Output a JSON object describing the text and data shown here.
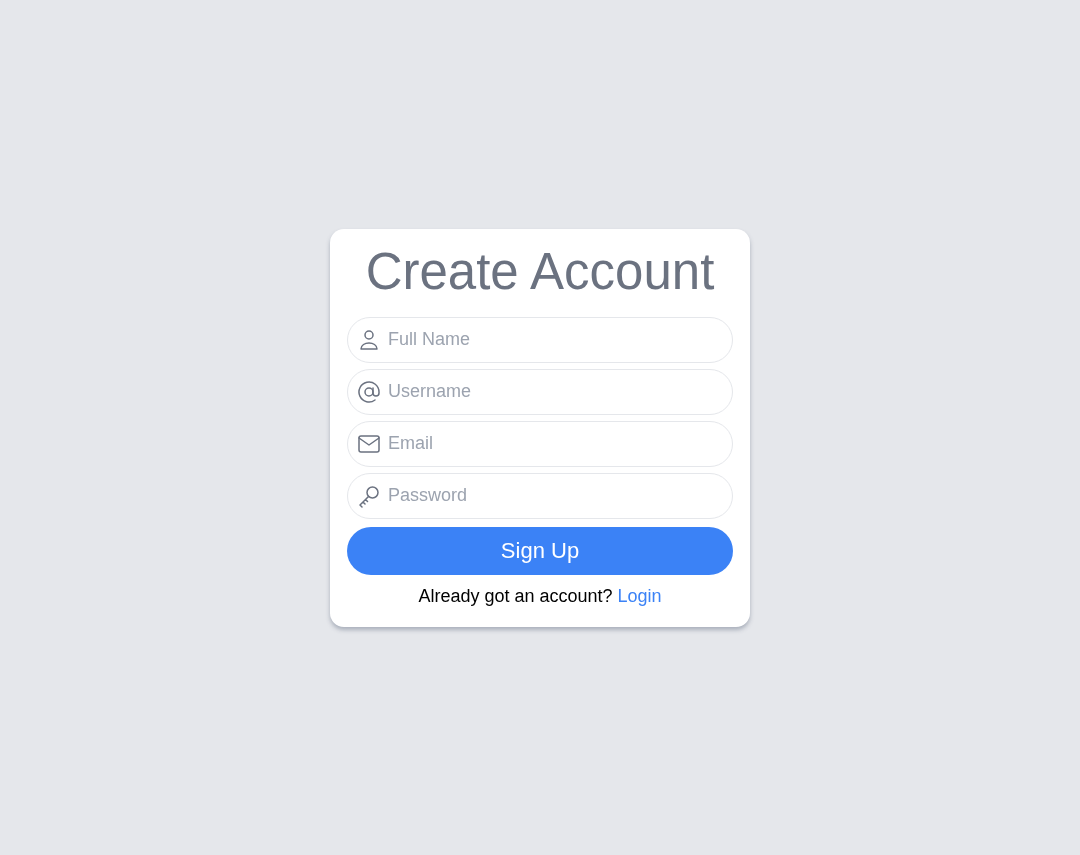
{
  "title": "Create Account",
  "fields": [
    {
      "kind": "person",
      "placeholder": "Full Name"
    },
    {
      "kind": "at",
      "placeholder": "Username"
    },
    {
      "kind": "mail",
      "placeholder": "Email"
    },
    {
      "kind": "key",
      "placeholder": "Password"
    }
  ],
  "submit": "Sign Up",
  "footer": {
    "prompt": "Already got an account?",
    "link": "Login"
  }
}
